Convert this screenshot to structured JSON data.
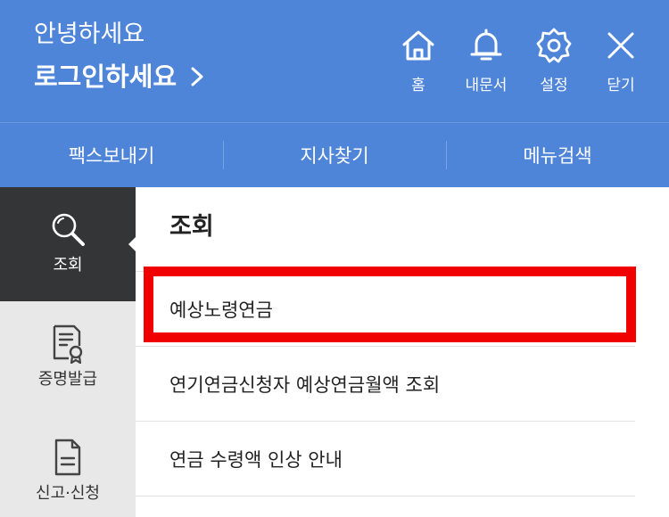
{
  "header": {
    "greeting": "안녕하세요",
    "login_label": "로그인하세요",
    "buttons": {
      "home": "홈",
      "inbox": "내문서",
      "settings": "설정",
      "close": "닫기"
    },
    "bg_color": "#4f85d8"
  },
  "quickbar": {
    "items": [
      "팩스보내기",
      "지사찾기",
      "메뉴검색"
    ]
  },
  "sidebar": {
    "items": [
      {
        "label": "조회",
        "icon": "search-icon",
        "active": true
      },
      {
        "label": "증명발급",
        "icon": "certificate-icon",
        "active": false
      },
      {
        "label": "신고·신청",
        "icon": "document-icon",
        "active": false
      }
    ]
  },
  "content": {
    "section_title": "조회",
    "items": [
      "예상노령연금",
      "연기연금신청자 예상연금월액 조회",
      "연금 수령액 인상 안내"
    ],
    "highlight_color": "#f00000"
  }
}
